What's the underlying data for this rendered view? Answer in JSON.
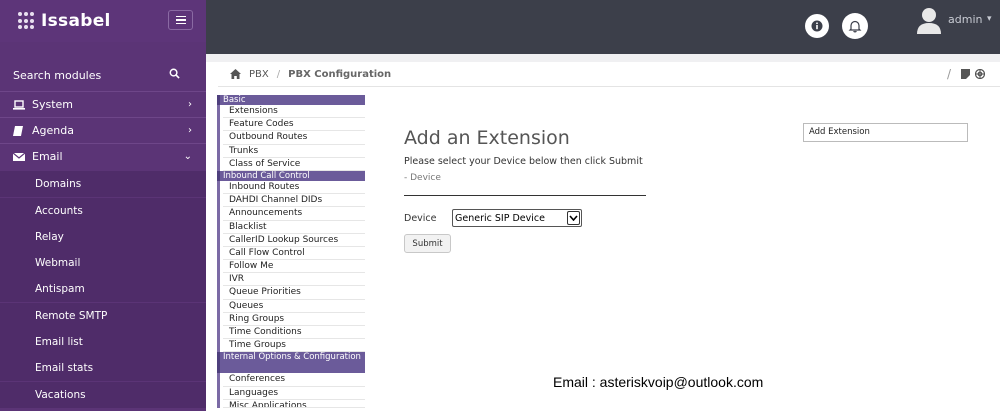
{
  "brand": {
    "name": "Issabel"
  },
  "sidebar": {
    "search_label": "Search modules",
    "top_items": [
      {
        "label": "System",
        "icon": "laptop-icon",
        "chevron": "›"
      },
      {
        "label": "Agenda",
        "icon": "book-icon",
        "chevron": "›"
      },
      {
        "label": "Email",
        "icon": "envelope-icon",
        "chevron": "⌄"
      }
    ],
    "email_subitems": [
      "Domains",
      "Accounts",
      "Relay",
      "Webmail",
      "Antispam",
      "Remote SMTP",
      "Email list",
      "Email stats",
      "Vacations"
    ]
  },
  "header": {
    "user_label": "admin",
    "caret": "▾"
  },
  "breadcrumb": {
    "section": "PBX",
    "separator": "/",
    "current": "PBX Configuration",
    "right_separator": "/"
  },
  "pbx_menu": {
    "sections": [
      {
        "title": "Basic",
        "items": [
          "Extensions",
          "Feature Codes",
          "Outbound Routes",
          "Trunks",
          "Class of Service"
        ]
      },
      {
        "title": "Inbound Call Control",
        "items": [
          "Inbound Routes",
          "DAHDI Channel DIDs",
          "Announcements",
          "Blacklist",
          "CallerID Lookup Sources",
          "Call Flow Control",
          "Follow Me",
          "IVR",
          "Queue Priorities",
          "Queues",
          "Ring Groups",
          "Time Conditions",
          "Time Groups"
        ]
      },
      {
        "title": "Internal Options & Configuration",
        "items": [
          "Conferences",
          "Languages",
          "Misc Applications"
        ]
      }
    ]
  },
  "form": {
    "title": "Add an Extension",
    "instruction": "Please select your Device below then click Submit",
    "device_hint": "- Device",
    "device_label": "Device",
    "device_selected": "Generic SIP Device",
    "submit_label": "Submit"
  },
  "right_panel": {
    "label": "Add Extension"
  },
  "watermark": {
    "text": "Email : asteriskvoip@outlook.com"
  },
  "colors": {
    "sidebar_bg": "#5b3476",
    "topbar_bg": "#3c3f4a",
    "pbx_section_bg": "#6b5b9a"
  }
}
